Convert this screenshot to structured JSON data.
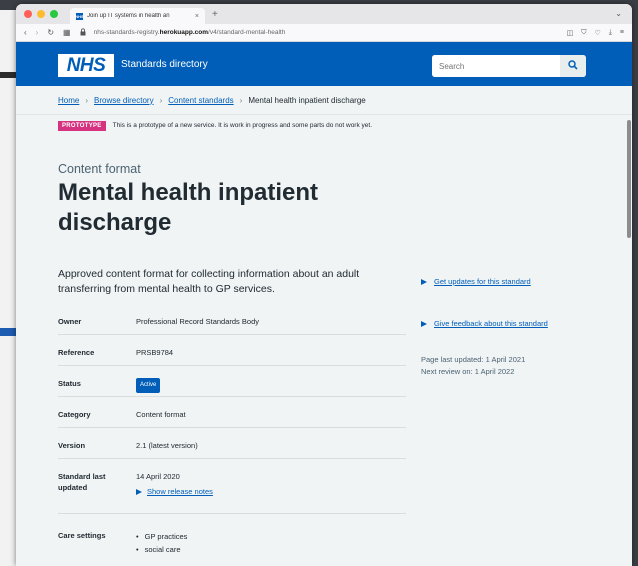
{
  "browser": {
    "tab_title": "Join up IT systems in health an",
    "tab_favicon": "NHS",
    "url_domain_prefix": "nhs-standards-registry.",
    "url_domain": "herokuapp.com",
    "url_path": "/v4/standard-mental-health"
  },
  "header": {
    "logo": "NHS",
    "service_name": "Standards directory",
    "search_placeholder": "Search"
  },
  "breadcrumbs": {
    "home": "Home",
    "browse": "Browse directory",
    "content_standards": "Content standards",
    "current": "Mental health inpatient discharge"
  },
  "banner": {
    "tag": "PROTOTYPE",
    "text": "This is a prototype of a new service. It is work in progress and some parts do not work yet."
  },
  "page": {
    "caption": "Content format",
    "title": "Mental health inpatient discharge",
    "lede": "Approved content format for collecting information about an adult transferring from mental health to GP services."
  },
  "summary": {
    "owner_key": "Owner",
    "owner_val": "Professional Record Standards Body",
    "reference_key": "Reference",
    "reference_val": "PRSB9784",
    "status_key": "Status",
    "status_val": "Active",
    "category_key": "Category",
    "category_val": "Content format",
    "version_key": "Version",
    "version_val": "2.1 (latest version)",
    "updated_key": "Standard last updated",
    "updated_val": "14 April 2020",
    "release_notes": "Show release notes",
    "care_key": "Care settings",
    "care_items": [
      "GP practices",
      "social care"
    ]
  },
  "sidebar": {
    "updates_link": "Get updates for this standard",
    "feedback_link": "Give feedback about this standard",
    "last_updated": "Page last updated: 1 April 2021",
    "next_review": "Next review on: 1 April 2022"
  },
  "colors": {
    "nhs_blue": "#005eb8",
    "prototype_pink": "#d5337f",
    "page_bg": "#f0f4f5"
  }
}
